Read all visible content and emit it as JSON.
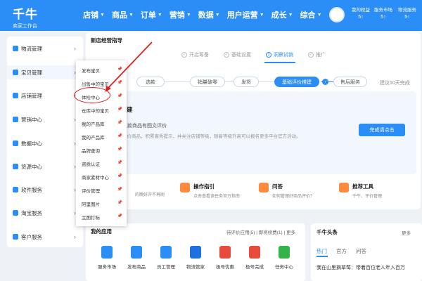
{
  "brand": {
    "name": "千牛",
    "subtitle": "卖家工作台"
  },
  "nav": [
    "店铺",
    "商品",
    "订单",
    "营销",
    "数据",
    "用户运营",
    "成长",
    "综合"
  ],
  "header_stats": [
    {
      "label": "我的权益",
      "value": "5↑"
    },
    {
      "label": "服务市场",
      "value": "5↑"
    },
    {
      "label": "物流服务",
      "value": "5↑"
    }
  ],
  "sidebar": [
    "物流管理",
    "宝贝管理",
    "店铺管理",
    "营销中心",
    "数据中心",
    "货源中心",
    "软件服务",
    "淘宝服务",
    "客户服务"
  ],
  "dropdown": [
    "发布宝贝",
    "出售中的宝贝",
    "体检中心",
    "仓库中的宝贝",
    "我的产品库",
    "我的产品库",
    "品牌查询",
    "资质认证",
    "商家素材中心",
    "评价管理",
    "阿里图片",
    "主图打标"
  ],
  "main": {
    "title": "新店经营指导",
    "steps": [
      "开店筹备",
      "基础设置",
      "洞察试销",
      "推广"
    ],
    "active_step_num": "3",
    "tasks": [
      "选款",
      "销量破零",
      "发货",
      "基础评价搭建",
      "售后服务"
    ],
    "task_hint": "建议10天完成",
    "task_heading": "建",
    "task_desc1": "三款商品有图文评价",
    "task_desc2": "评价商品，积累客秀提示，并关注店铺等级，随着等级升高可以报名更多平台官方活动。",
    "complete_button": "完成请点击",
    "tools": [
      {
        "title": "操作指引",
        "sub": "点击查看该任务官方指南"
      },
      {
        "title": "问答",
        "sub": "如何管理好商品评价？"
      },
      {
        "title": "推荐工具",
        "sub": "千牛、评价管理"
      }
    ],
    "tool_fragment": "的晚好评不再刷"
  },
  "apps": {
    "title": "我的应用",
    "stats": "待评价应用(5) | 即将续费(1) | 更多",
    "items": [
      "服务市场",
      "发布商品",
      "员工管理",
      "物流管家",
      "极号优惠",
      "极号完成",
      "任务中心"
    ]
  },
  "news": {
    "title": "千牛头条",
    "more": "更多",
    "tabs": [
      "热门",
      "官方",
      "问答"
    ],
    "item": "我在山里摘草莓：带着百位老人年入百万"
  },
  "colors": {
    "accent": "#2b8df6",
    "annotation": "#e02020",
    "tool_orange": "#ff8a3d"
  }
}
